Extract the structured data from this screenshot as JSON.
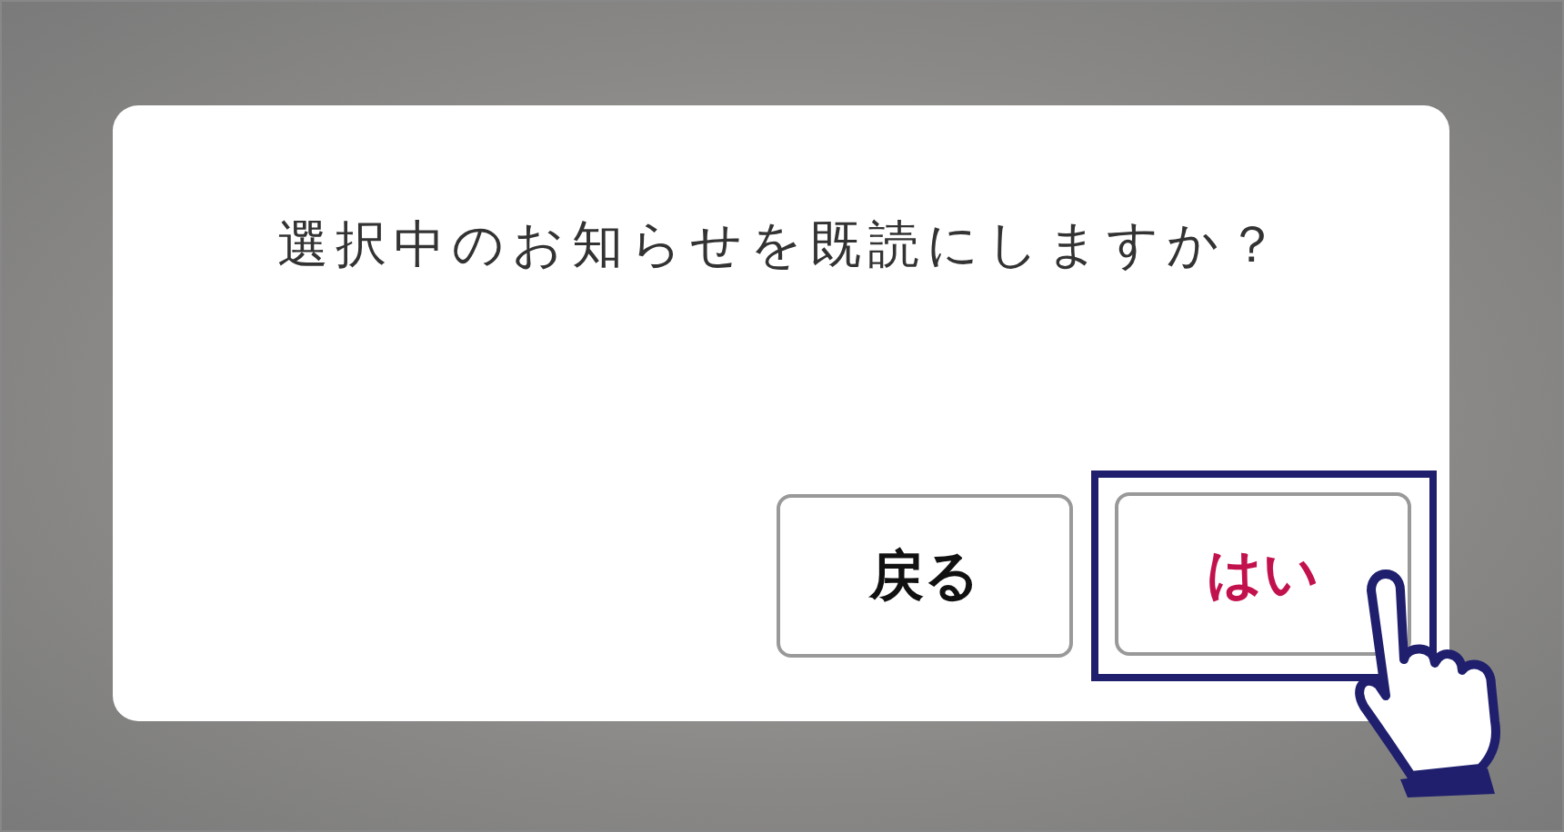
{
  "dialog": {
    "message": "選択中のお知らせを既読にしますか？",
    "buttons": [
      {
        "label": "戻る",
        "kind": "secondary",
        "highlighted": false
      },
      {
        "label": "はい",
        "kind": "primary",
        "highlighted": true
      }
    ]
  }
}
